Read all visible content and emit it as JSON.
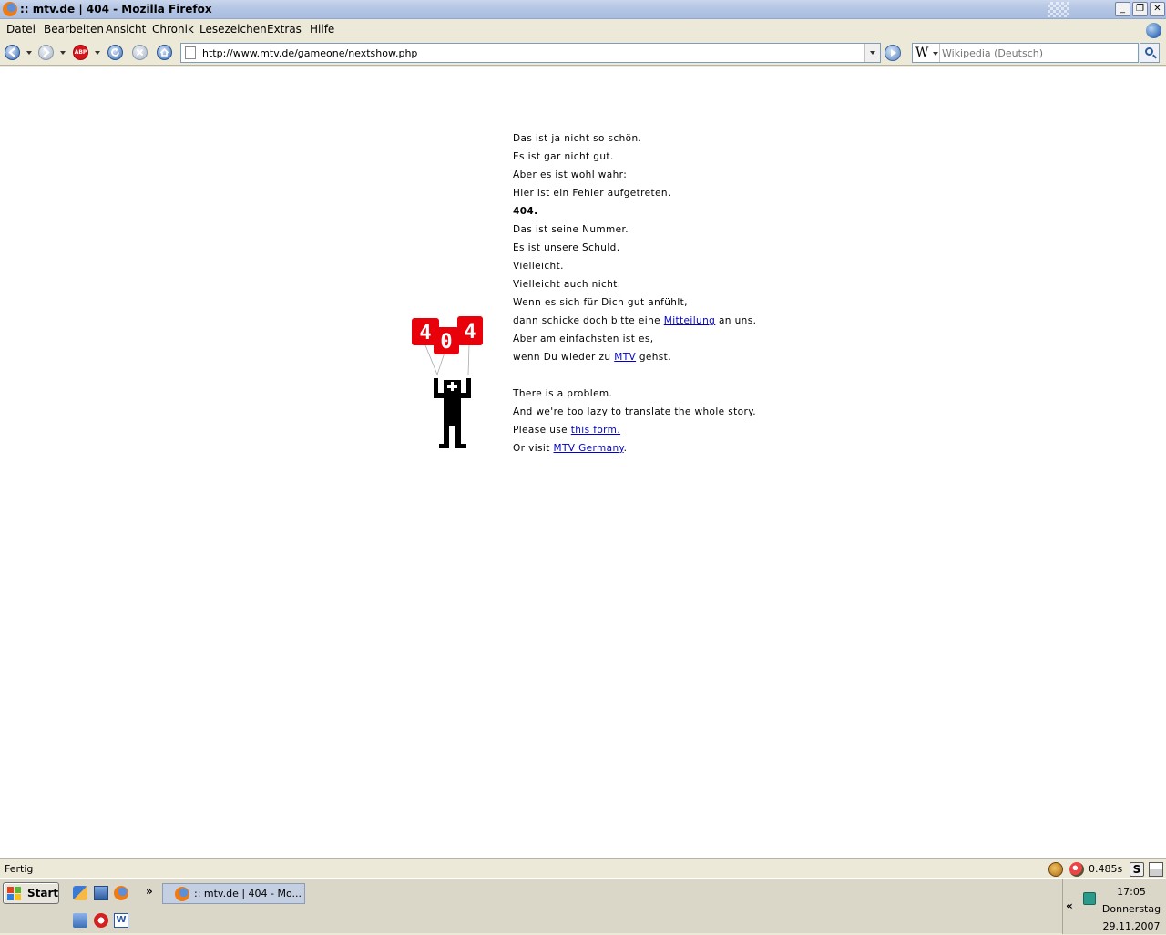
{
  "window": {
    "title": ":: mtv.de | 404 - Mozilla Firefox",
    "minimize": "_",
    "restore": "❐",
    "close": "✕"
  },
  "menu": {
    "items": [
      "Datei",
      "Bearbeiten",
      "Ansicht",
      "Chronik",
      "Lesezeichen",
      "Extras",
      "Hilfe"
    ]
  },
  "toolbar": {
    "url": "http://www.mtv.de/gameone/nextshow.php",
    "search_engine": "W",
    "search_placeholder": "Wikipedia (Deutsch)",
    "adblock_label": "ABP"
  },
  "page": {
    "german_lines": [
      "Das ist ja nicht so schön.",
      "Es ist gar nicht gut.",
      "Aber es ist wohl wahr:",
      "Hier ist ein Fehler aufgetreten.",
      "404.",
      "Das ist seine Nummer.",
      "Es ist unsere Schuld.",
      "Vielleicht.",
      "Vielleicht auch nicht.",
      "Wenn es sich für Dich gut anfühlt,"
    ],
    "line_mitteilung": {
      "before": "dann schicke doch bitte eine ",
      "link": "Mitteilung",
      "after": " an uns."
    },
    "line_einfach": "Aber am einfachsten ist es,",
    "line_mtv": {
      "before": "wenn Du wieder zu ",
      "link": "MTV",
      "after": " gehst."
    },
    "english_lines": [
      "There is a problem.",
      "And we're too lazy to translate the whole story."
    ],
    "line_form": {
      "before": "Please use ",
      "link": "this form."
    },
    "line_visit": {
      "before": "Or visit ",
      "link": "MTV Germany",
      "after": "."
    },
    "balloon_digits": [
      "4",
      "0",
      "4"
    ],
    "balloon_color": "#e8000a",
    "link_color": "#0000cc"
  },
  "statusbar": {
    "text": "Fertig",
    "timing": "0.485s"
  },
  "taskbar": {
    "start_label": "Start",
    "task_label": ":: mtv.de | 404 - Mo...",
    "chevron": "»",
    "tray_expand": "«",
    "clock_time": "17:05",
    "clock_day": "Donnerstag",
    "clock_date": "29.11.2007"
  }
}
